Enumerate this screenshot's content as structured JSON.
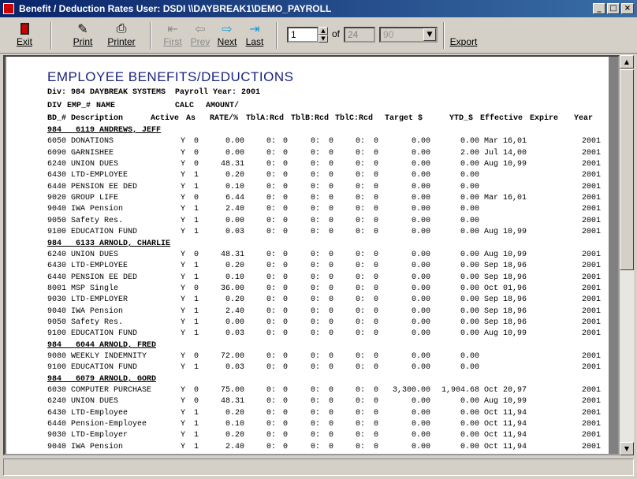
{
  "window": {
    "title": "Benefit / Deduction Rates  User: DSDI  \\\\DAYBREAK1\\DEMO_PAYROLL",
    "buttons": [
      "_",
      "□",
      "×"
    ]
  },
  "toolbar": {
    "exit": "Exit",
    "print": "Print",
    "printer": "Printer",
    "first": "First",
    "prev": "Prev",
    "next": "Next",
    "last": "Last",
    "page_value": "1",
    "of_label": "of",
    "page_total": "24",
    "zoom_value": "90",
    "export": "Export"
  },
  "report": {
    "title": "EMPLOYEE BENEFITS/DEDUCTIONS",
    "div_line": "Div: 984 DAYBREAK SYSTEMS  Payroll Year: 2001",
    "header1": {
      "div": "DIV",
      "emp": "EMP_#",
      "name": "NAME",
      "calc": "CALC",
      "amount": "AMOUNT/"
    },
    "header2": {
      "bd": "BD_#",
      "desc": "Description",
      "active": "Active",
      "as": "As",
      "rate": "RATE/%",
      "tbla": "TblA:Rcd",
      "tblb": "TblB:Rcd",
      "tblc": "TblC:Rcd",
      "target": "Target $",
      "ytd": "YTD_$",
      "effective": "Effective",
      "expire": "Expire",
      "year": "Year"
    },
    "rows": [
      {
        "g": "984   6119 ANDREWS, JEFF"
      },
      {
        "bd": "6050",
        "desc": "DONATIONS",
        "act": "Y",
        "as": "0",
        "rate": "0.00",
        "a": "0:",
        "ar": "0",
        "b": "0:",
        "br": "0",
        "c": "0:",
        "cr": "0",
        "target": "0.00",
        "ytd": "0.00",
        "eff": "Mar 16,01",
        "year": "2001"
      },
      {
        "bd": "6090",
        "desc": "GARNISHEE",
        "act": "Y",
        "as": "0",
        "rate": "0.00",
        "a": "0:",
        "ar": "0",
        "b": "0:",
        "br": "0",
        "c": "0:",
        "cr": "0",
        "target": "0.00",
        "ytd": "2.00",
        "eff": "Jul 14,00",
        "year": "2001"
      },
      {
        "bd": "6240",
        "desc": "UNION DUES",
        "act": "Y",
        "as": "0",
        "rate": "48.31",
        "a": "0:",
        "ar": "0",
        "b": "0:",
        "br": "0",
        "c": "0:",
        "cr": "0",
        "target": "0.00",
        "ytd": "0.00",
        "eff": "Aug 10,99",
        "year": "2001"
      },
      {
        "bd": "6430",
        "desc": "LTD-EMPLOYEE",
        "act": "Y",
        "as": "1",
        "rate": "0.20",
        "a": "0:",
        "ar": "0",
        "b": "0:",
        "br": "0",
        "c": "0:",
        "cr": "0",
        "target": "0.00",
        "ytd": "0.00",
        "eff": "",
        "year": "2001"
      },
      {
        "bd": "6440",
        "desc": "PENSION EE DED",
        "act": "Y",
        "as": "1",
        "rate": "0.10",
        "a": "0:",
        "ar": "0",
        "b": "0:",
        "br": "0",
        "c": "0:",
        "cr": "0",
        "target": "0.00",
        "ytd": "0.00",
        "eff": "",
        "year": "2001"
      },
      {
        "bd": "9020",
        "desc": "GROUP LIFE",
        "act": "Y",
        "as": "0",
        "rate": "6.44",
        "a": "0:",
        "ar": "0",
        "b": "0:",
        "br": "0",
        "c": "0:",
        "cr": "0",
        "target": "0.00",
        "ytd": "0.00",
        "eff": "Mar 16,01",
        "year": "2001"
      },
      {
        "bd": "9040",
        "desc": "IWA Pension",
        "act": "Y",
        "as": "1",
        "rate": "2.40",
        "a": "0:",
        "ar": "0",
        "b": "0:",
        "br": "0",
        "c": "0:",
        "cr": "0",
        "target": "0.00",
        "ytd": "0.00",
        "eff": "",
        "year": "2001"
      },
      {
        "bd": "9050",
        "desc": "Safety Res.",
        "act": "Y",
        "as": "1",
        "rate": "0.00",
        "a": "0:",
        "ar": "0",
        "b": "0:",
        "br": "0",
        "c": "0:",
        "cr": "0",
        "target": "0.00",
        "ytd": "0.00",
        "eff": "",
        "year": "2001"
      },
      {
        "bd": "9100",
        "desc": "EDUCATION FUND",
        "act": "Y",
        "as": "1",
        "rate": "0.03",
        "a": "0:",
        "ar": "0",
        "b": "0:",
        "br": "0",
        "c": "0:",
        "cr": "0",
        "target": "0.00",
        "ytd": "0.00",
        "eff": "Aug 10,99",
        "year": "2001"
      },
      {
        "g": "984   6133 ARNOLD, CHARLIE"
      },
      {
        "bd": "6240",
        "desc": "UNION DUES",
        "act": "Y",
        "as": "0",
        "rate": "48.31",
        "a": "0:",
        "ar": "0",
        "b": "0:",
        "br": "0",
        "c": "0:",
        "cr": "0",
        "target": "0.00",
        "ytd": "0.00",
        "eff": "Aug 10,99",
        "year": "2001"
      },
      {
        "bd": "6430",
        "desc": "LTD-EMPLOYEE",
        "act": "Y",
        "as": "1",
        "rate": "0.20",
        "a": "0:",
        "ar": "0",
        "b": "0:",
        "br": "0",
        "c": "0:",
        "cr": "0",
        "target": "0.00",
        "ytd": "0.00",
        "eff": "Sep 18,96",
        "year": "2001"
      },
      {
        "bd": "6440",
        "desc": "PENSION EE DED",
        "act": "Y",
        "as": "1",
        "rate": "0.10",
        "a": "0:",
        "ar": "0",
        "b": "0:",
        "br": "0",
        "c": "0:",
        "cr": "0",
        "target": "0.00",
        "ytd": "0.00",
        "eff": "Sep 18,96",
        "year": "2001"
      },
      {
        "bd": "8001",
        "desc": "MSP Single",
        "act": "Y",
        "as": "0",
        "rate": "36.00",
        "a": "0:",
        "ar": "0",
        "b": "0:",
        "br": "0",
        "c": "0:",
        "cr": "0",
        "target": "0.00",
        "ytd": "0.00",
        "eff": "Oct 01,96",
        "year": "2001"
      },
      {
        "bd": "9030",
        "desc": "LTD-EMPLOYER",
        "act": "Y",
        "as": "1",
        "rate": "0.20",
        "a": "0:",
        "ar": "0",
        "b": "0:",
        "br": "0",
        "c": "0:",
        "cr": "0",
        "target": "0.00",
        "ytd": "0.00",
        "eff": "Sep 18,96",
        "year": "2001"
      },
      {
        "bd": "9040",
        "desc": "IWA Pension",
        "act": "Y",
        "as": "1",
        "rate": "2.40",
        "a": "0:",
        "ar": "0",
        "b": "0:",
        "br": "0",
        "c": "0:",
        "cr": "0",
        "target": "0.00",
        "ytd": "0.00",
        "eff": "Sep 18,96",
        "year": "2001"
      },
      {
        "bd": "9050",
        "desc": "Safety Res.",
        "act": "Y",
        "as": "1",
        "rate": "0.00",
        "a": "0:",
        "ar": "0",
        "b": "0:",
        "br": "0",
        "c": "0:",
        "cr": "0",
        "target": "0.00",
        "ytd": "0.00",
        "eff": "Sep 18,96",
        "year": "2001"
      },
      {
        "bd": "9100",
        "desc": "EDUCATION FUND",
        "act": "Y",
        "as": "1",
        "rate": "0.03",
        "a": "0:",
        "ar": "0",
        "b": "0:",
        "br": "0",
        "c": "0:",
        "cr": "0",
        "target": "0.00",
        "ytd": "0.00",
        "eff": "Aug 10,99",
        "year": "2001"
      },
      {
        "g": "984   6044 ARNOLD, FRED"
      },
      {
        "bd": "9080",
        "desc": "WEEKLY INDEMNITY",
        "act": "Y",
        "as": "0",
        "rate": "72.00",
        "a": "0:",
        "ar": "0",
        "b": "0:",
        "br": "0",
        "c": "0:",
        "cr": "0",
        "target": "0.00",
        "ytd": "0.00",
        "eff": "",
        "year": "2001"
      },
      {
        "bd": "9100",
        "desc": "EDUCATION FUND",
        "act": "Y",
        "as": "1",
        "rate": "0.03",
        "a": "0:",
        "ar": "0",
        "b": "0:",
        "br": "0",
        "c": "0:",
        "cr": "0",
        "target": "0.00",
        "ytd": "0.00",
        "eff": "",
        "year": "2001"
      },
      {
        "g": "984   6079 ARNOLD, GORD"
      },
      {
        "bd": "6030",
        "desc": "COMPUTER PURCHASE",
        "act": "Y",
        "as": "0",
        "rate": "75.00",
        "a": "0:",
        "ar": "0",
        "b": "0:",
        "br": "0",
        "c": "0:",
        "cr": "0",
        "target": "3,300.00",
        "ytd": "1,904.68",
        "eff": "Oct 20,97",
        "year": "2001"
      },
      {
        "bd": "6240",
        "desc": "UNION DUES",
        "act": "Y",
        "as": "0",
        "rate": "48.31",
        "a": "0:",
        "ar": "0",
        "b": "0:",
        "br": "0",
        "c": "0:",
        "cr": "0",
        "target": "0.00",
        "ytd": "0.00",
        "eff": "Aug 10,99",
        "year": "2001"
      },
      {
        "bd": "6430",
        "desc": "LTD-Employee",
        "act": "Y",
        "as": "1",
        "rate": "0.20",
        "a": "0:",
        "ar": "0",
        "b": "0:",
        "br": "0",
        "c": "0:",
        "cr": "0",
        "target": "0.00",
        "ytd": "0.00",
        "eff": "Oct 11,94",
        "year": "2001"
      },
      {
        "bd": "6440",
        "desc": "Pension-Employee",
        "act": "Y",
        "as": "1",
        "rate": "0.10",
        "a": "0:",
        "ar": "0",
        "b": "0:",
        "br": "0",
        "c": "0:",
        "cr": "0",
        "target": "0.00",
        "ytd": "0.00",
        "eff": "Oct 11,94",
        "year": "2001"
      },
      {
        "bd": "9030",
        "desc": "LTD-Employer",
        "act": "Y",
        "as": "1",
        "rate": "0.20",
        "a": "0:",
        "ar": "0",
        "b": "0:",
        "br": "0",
        "c": "0:",
        "cr": "0",
        "target": "0.00",
        "ytd": "0.00",
        "eff": "Oct 11,94",
        "year": "2001"
      },
      {
        "bd": "9040",
        "desc": "IWA Pension",
        "act": "Y",
        "as": "1",
        "rate": "2.40",
        "a": "0:",
        "ar": "0",
        "b": "0:",
        "br": "0",
        "c": "0:",
        "cr": "0",
        "target": "0.00",
        "ytd": "0.00",
        "eff": "Oct 11,94",
        "year": "2001"
      }
    ]
  }
}
